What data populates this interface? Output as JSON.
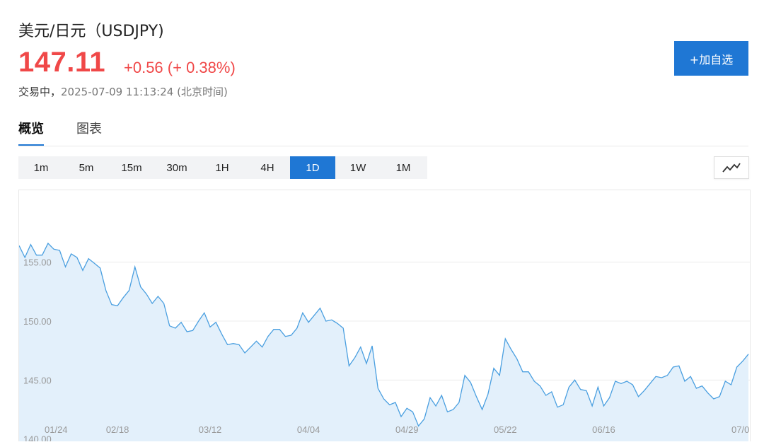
{
  "header": {
    "title": "美元/日元（USDJPY)",
    "price": "147.11",
    "change": "+0.56 (+ 0.38%)",
    "status_label": "交易中，",
    "timestamp": "2025-07-09 11:13:24 (北京时间)",
    "add_button": "+加自选"
  },
  "colors": {
    "up": "#f04848",
    "accent": "#1f77d4",
    "line": "#4a9fe0",
    "area": "#e3f0fb"
  },
  "tabs": [
    {
      "label": "概览",
      "active": true
    },
    {
      "label": "图表",
      "active": false
    }
  ],
  "intervals": [
    {
      "label": "1m",
      "active": false
    },
    {
      "label": "5m",
      "active": false
    },
    {
      "label": "15m",
      "active": false
    },
    {
      "label": "30m",
      "active": false
    },
    {
      "label": "1H",
      "active": false
    },
    {
      "label": "4H",
      "active": false
    },
    {
      "label": "1D",
      "active": true
    },
    {
      "label": "1W",
      "active": false
    },
    {
      "label": "1M",
      "active": false
    }
  ],
  "chart_type_icon": "line-chart-icon",
  "chart_data": {
    "type": "area",
    "title": "",
    "xlabel": "",
    "ylabel": "",
    "ylim": [
      139.8,
      161.1
    ],
    "yticks": [
      140.0,
      145.0,
      150.0,
      155.0
    ],
    "ytick_labels": [
      "140.00",
      "145.00",
      "150.00",
      "155.00"
    ],
    "xtick_labels": [
      "01/24",
      "02/18",
      "03/12",
      "04/04",
      "04/29",
      "05/22",
      "06/16",
      "07/0"
    ],
    "xtick_index": [
      0,
      17,
      33,
      50,
      67,
      84,
      101,
      118
    ],
    "grid": true,
    "series": [
      {
        "values": [
          156.4,
          155.4,
          156.5,
          155.6,
          155.6,
          156.6,
          156.1,
          156.0,
          154.6,
          155.7,
          155.4,
          154.3,
          155.3,
          154.9,
          154.5,
          152.6,
          151.4,
          151.3,
          152.0,
          152.6,
          154.6,
          152.9,
          152.3,
          151.5,
          152.1,
          151.5,
          149.6,
          149.4,
          149.9,
          149.1,
          149.2,
          150.0,
          150.7,
          149.5,
          149.9,
          148.9,
          148.0,
          148.1,
          148.0,
          147.3,
          147.8,
          148.3,
          147.8,
          148.7,
          149.3,
          149.3,
          148.7,
          148.8,
          149.4,
          150.7,
          149.9,
          150.5,
          151.1,
          150.0,
          150.1,
          149.8,
          149.4,
          146.2,
          146.9,
          147.8,
          146.4,
          147.9,
          144.3,
          143.4,
          142.9,
          143.1,
          141.9,
          142.6,
          142.3,
          141.1,
          141.7,
          143.5,
          142.8,
          143.7,
          142.3,
          142.5,
          143.1,
          145.4,
          144.8,
          143.6,
          142.5,
          143.8,
          146.0,
          145.4,
          148.5,
          147.6,
          146.8,
          145.7,
          145.7,
          144.9,
          144.5,
          143.7,
          144.0,
          142.7,
          142.9,
          144.4,
          145.0,
          144.2,
          144.1,
          142.8,
          144.4,
          142.8,
          143.5,
          144.9,
          144.7,
          144.9,
          144.6,
          143.6,
          144.1,
          144.7,
          145.3,
          145.2,
          145.4,
          146.1,
          146.2,
          144.9,
          145.3,
          144.3,
          144.5,
          143.9,
          143.4,
          143.6,
          144.9,
          144.6,
          146.1,
          146.6,
          147.2
        ]
      }
    ]
  }
}
